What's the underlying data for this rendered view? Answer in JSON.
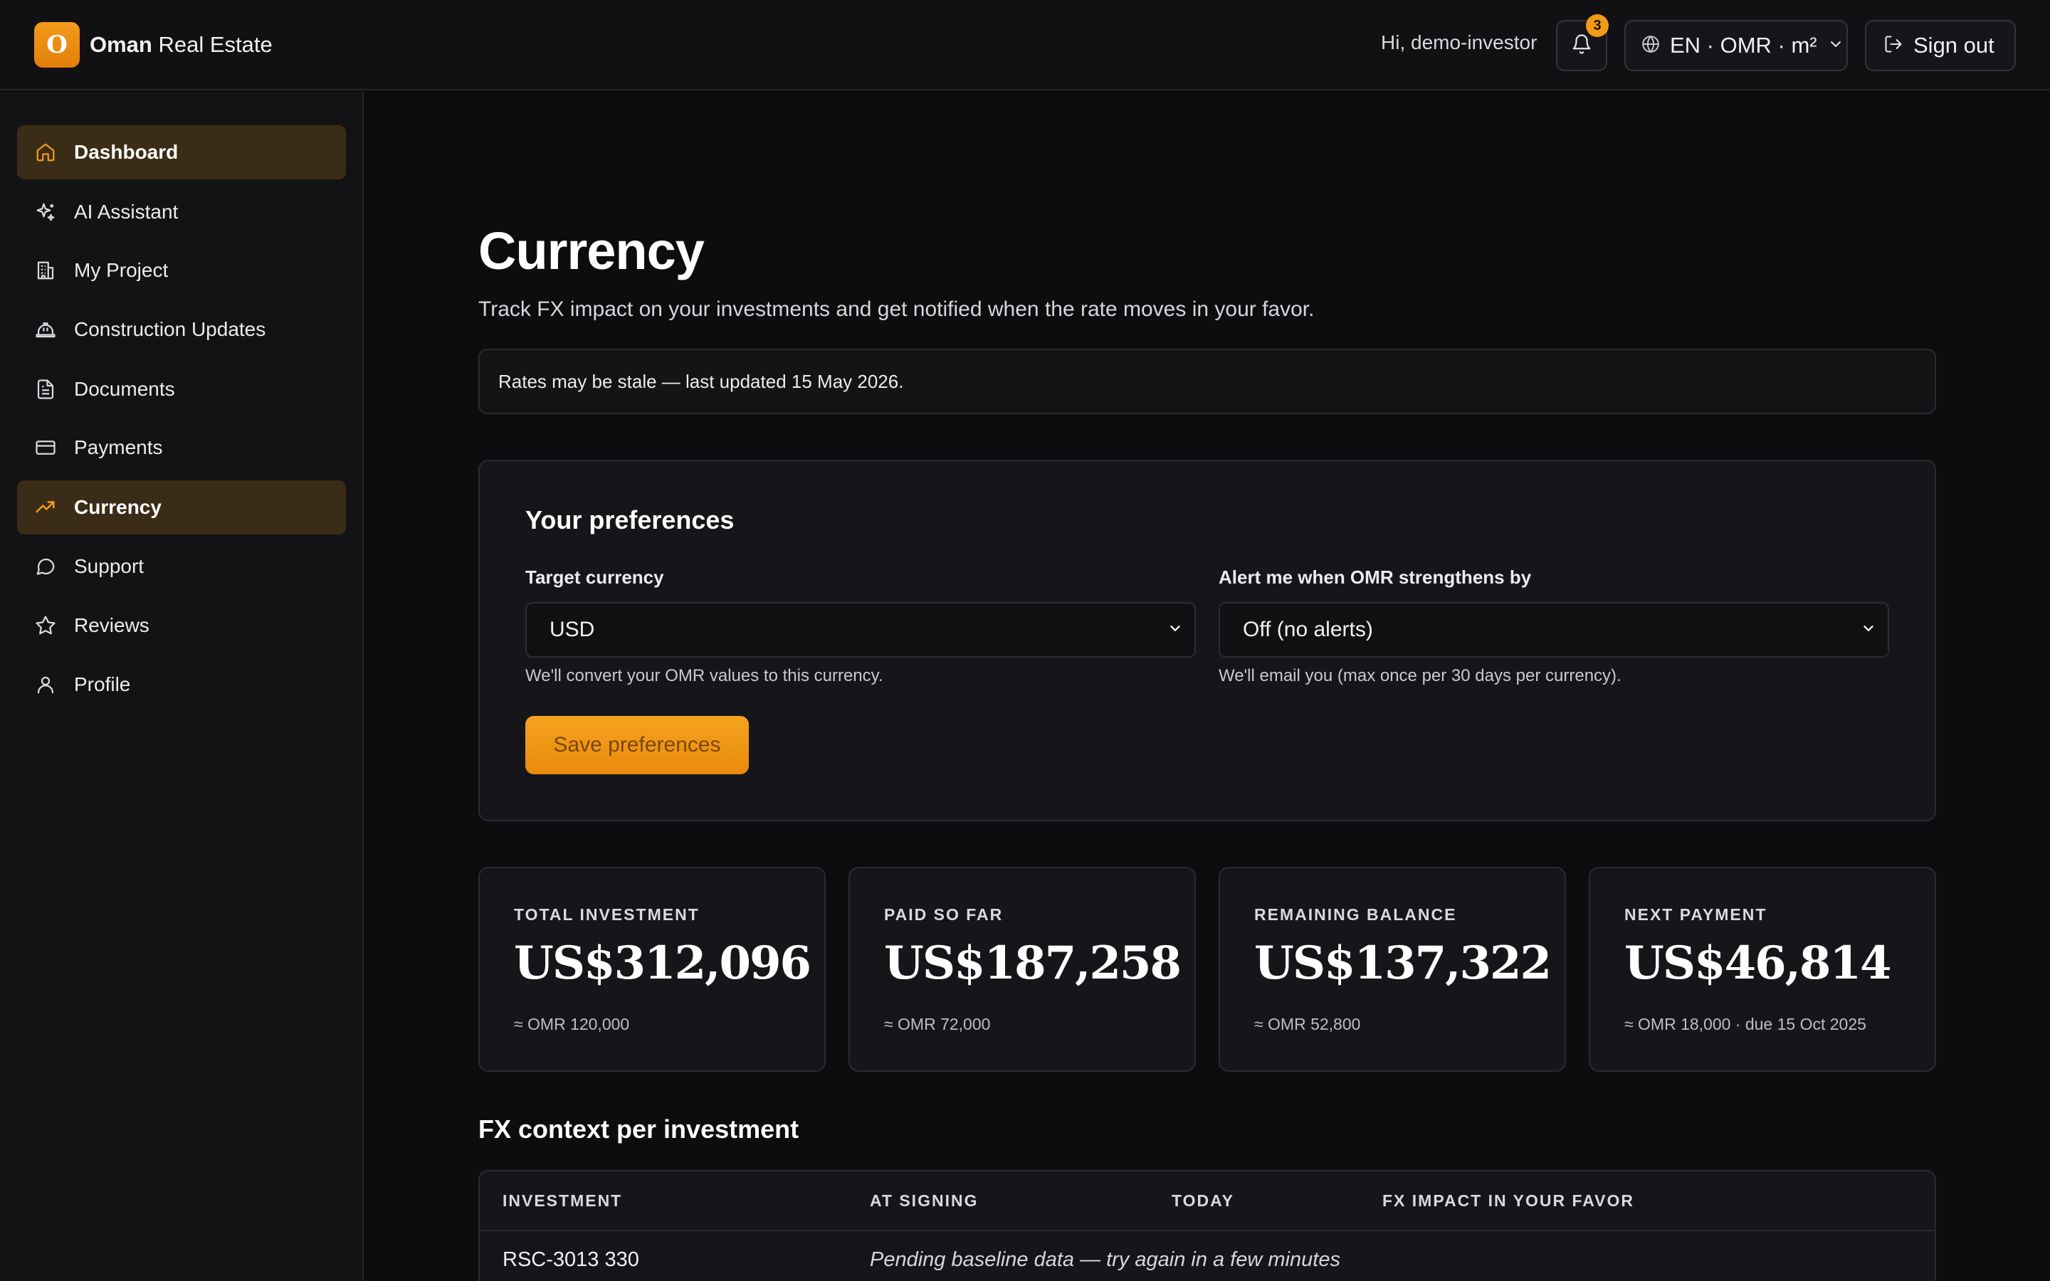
{
  "brand": {
    "initial": "O",
    "name_bold": "Oman",
    "name_rest": " Real Estate"
  },
  "header": {
    "greeting": "Hi, demo-investor",
    "notification_count": "3",
    "locale": "EN · OMR · m²",
    "sign_out": "Sign out"
  },
  "sidebar": {
    "items": [
      {
        "label": "Dashboard",
        "icon": "home-icon",
        "active": true
      },
      {
        "label": "AI Assistant",
        "icon": "sparkles-icon",
        "active": false
      },
      {
        "label": "My Project",
        "icon": "building-icon",
        "active": false
      },
      {
        "label": "Construction Updates",
        "icon": "hard-hat-icon",
        "active": false
      },
      {
        "label": "Documents",
        "icon": "document-icon",
        "active": false
      },
      {
        "label": "Payments",
        "icon": "credit-card-icon",
        "active": false
      },
      {
        "label": "Currency",
        "icon": "trending-up-icon",
        "active": true
      },
      {
        "label": "Support",
        "icon": "chat-bubble-icon",
        "active": false
      },
      {
        "label": "Reviews",
        "icon": "star-icon",
        "active": false
      },
      {
        "label": "Profile",
        "icon": "user-icon",
        "active": false
      }
    ]
  },
  "page": {
    "title": "Currency",
    "subtitle": "Track FX impact on your investments and get notified when the rate moves in your favor.",
    "stale_notice": "Rates may be stale — last updated 15 May 2026."
  },
  "preferences": {
    "title": "Your preferences",
    "target_currency": {
      "label": "Target currency",
      "value": "USD",
      "help": "We'll convert your OMR values to this currency."
    },
    "alert": {
      "label": "Alert me when OMR strengthens by",
      "value": "Off (no alerts)",
      "help": "We'll email you (max once per 30 days per currency)."
    },
    "save_label": "Save preferences"
  },
  "stats": [
    {
      "label": "TOTAL INVESTMENT",
      "value": "US$312,096",
      "sub": "≈ OMR 120,000"
    },
    {
      "label": "PAID SO FAR",
      "value": "US$187,258",
      "sub": "≈ OMR 72,000"
    },
    {
      "label": "REMAINING BALANCE",
      "value": "US$137,322",
      "sub": "≈ OMR 52,800"
    },
    {
      "label": "NEXT PAYMENT",
      "value": "US$46,814",
      "sub": "≈ OMR 18,000 · due 15 Oct 2025"
    }
  ],
  "fx": {
    "title": "FX context per investment",
    "columns": [
      "INVESTMENT",
      "AT SIGNING",
      "TODAY",
      "FX IMPACT IN YOUR FAVOR"
    ],
    "rows": [
      {
        "investment": "RSC-3013 330",
        "status": "Pending baseline data — try again in a few minutes"
      }
    ]
  },
  "colors": {
    "accent": "#f29b19",
    "active_bg": "#3b2c17",
    "background": "#0d0d10"
  }
}
